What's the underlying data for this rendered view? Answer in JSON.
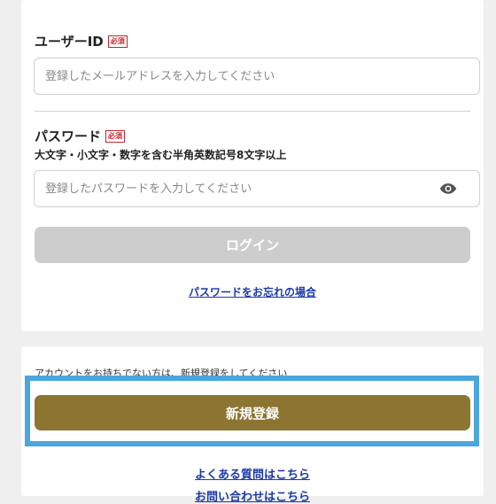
{
  "login": {
    "user_id_label": "ユーザーID",
    "required_badge": "必須",
    "user_id_placeholder": "登録したメールアドレスを入力してください",
    "password_label": "パスワード",
    "password_hint": "大文字・小文字・数字を含む半角英数記号8文字以上",
    "password_placeholder": "登録したパスワードを入力してください",
    "login_button": "ログイン",
    "forgot_link": "パスワードをお忘れの場合"
  },
  "register": {
    "message": "アカウントをお持ちでない方は、新規登録をしてください",
    "register_button": "新規登録",
    "faq_link": "よくある質問はこちら",
    "contact_link": "お問い合わせはこちら"
  },
  "colors": {
    "register_button_bg": "#8c7431",
    "login_button_bg": "#cdcdcd",
    "highlight_frame": "#4aa6dc",
    "required_badge": "#c8232c",
    "link": "#1a3aa8"
  },
  "icons": {
    "password_toggle": "eye-icon"
  }
}
